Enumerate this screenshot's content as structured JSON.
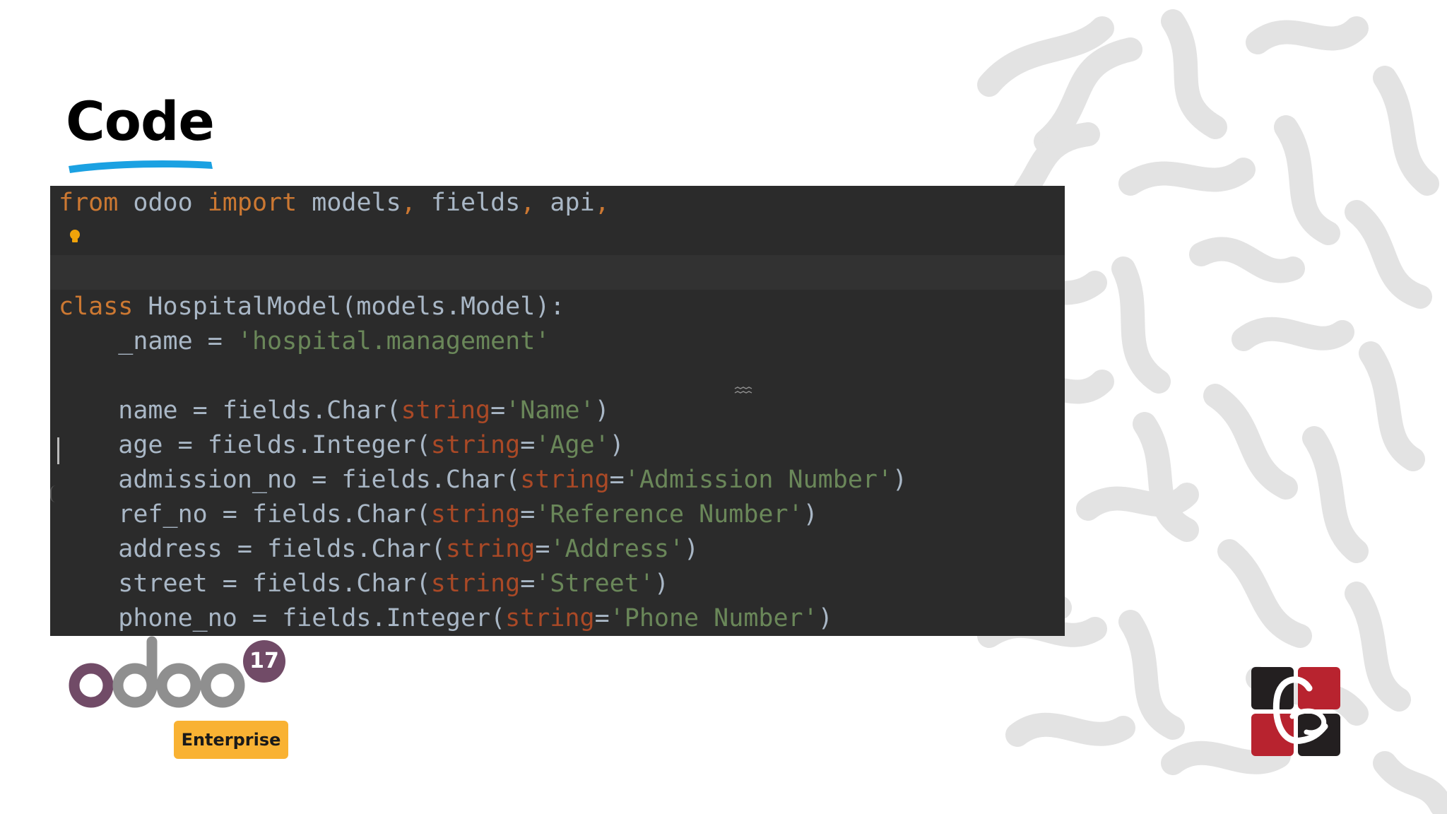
{
  "slide": {
    "title": "Code"
  },
  "code_editor": {
    "lines": [
      [
        {
          "t": "from",
          "c": "kw"
        },
        {
          "t": " odoo ",
          "c": "plain"
        },
        {
          "t": "import",
          "c": "kw"
        },
        {
          "t": " models",
          "c": "plain"
        },
        {
          "t": ",",
          "c": "kw"
        },
        {
          "t": " fields",
          "c": "plain"
        },
        {
          "t": ",",
          "c": "kw"
        },
        {
          "t": " api",
          "c": "plain"
        },
        {
          "t": ",",
          "c": "kw"
        }
      ],
      [],
      [],
      [
        {
          "t": "class",
          "c": "kw"
        },
        {
          "t": " HospitalModel(models.Model):",
          "c": "plain"
        }
      ],
      [
        {
          "t": "    _name = ",
          "c": "plain"
        },
        {
          "t": "'hospital.management'",
          "c": "str"
        }
      ],
      [],
      [
        {
          "t": "    name = fields.Char(",
          "c": "plain"
        },
        {
          "t": "string",
          "c": "param"
        },
        {
          "t": "=",
          "c": "plain"
        },
        {
          "t": "'Name'",
          "c": "str"
        },
        {
          "t": ")",
          "c": "plain"
        }
      ],
      [
        {
          "t": "    age = fields.Integer(",
          "c": "plain"
        },
        {
          "t": "string",
          "c": "param"
        },
        {
          "t": "=",
          "c": "plain"
        },
        {
          "t": "'Age'",
          "c": "str"
        },
        {
          "t": ")",
          "c": "plain"
        }
      ],
      [
        {
          "t": "    admission_no = fields.Char(",
          "c": "plain"
        },
        {
          "t": "string",
          "c": "param"
        },
        {
          "t": "=",
          "c": "plain"
        },
        {
          "t": "'Admission Number'",
          "c": "str"
        },
        {
          "t": ")",
          "c": "plain"
        }
      ],
      [
        {
          "t": "    ref_no = fields.Char(",
          "c": "plain"
        },
        {
          "t": "string",
          "c": "param"
        },
        {
          "t": "=",
          "c": "plain"
        },
        {
          "t": "'Reference Number'",
          "c": "str"
        },
        {
          "t": ")",
          "c": "plain"
        }
      ],
      [
        {
          "t": "    address = fields.Char(",
          "c": "plain"
        },
        {
          "t": "string",
          "c": "param"
        },
        {
          "t": "=",
          "c": "plain"
        },
        {
          "t": "'Address'",
          "c": "str"
        },
        {
          "t": ")",
          "c": "plain"
        }
      ],
      [
        {
          "t": "    street = fields.Char(",
          "c": "plain"
        },
        {
          "t": "string",
          "c": "param"
        },
        {
          "t": "=",
          "c": "plain"
        },
        {
          "t": "'Street'",
          "c": "str"
        },
        {
          "t": ")",
          "c": "plain"
        }
      ],
      [
        {
          "t": "    phone_no = fields.Integer(",
          "c": "plain"
        },
        {
          "t": "string",
          "c": "param"
        },
        {
          "t": "=",
          "c": "plain"
        },
        {
          "t": "'Phone Number'",
          "c": "str"
        },
        {
          "t": ")",
          "c": "plain"
        }
      ]
    ],
    "current_line_index": 2,
    "theme": {
      "background": "#2b2b2b",
      "keyword": "#cc7832",
      "parameter": "#aa4926",
      "string": "#6a8759",
      "default": "#a9b7c6"
    }
  },
  "icons": {
    "intention_bulb": "lightbulb-icon",
    "pattern": "decorative-squiggle-pattern"
  },
  "footer": {
    "product_logo_text": "odoo",
    "version": "17",
    "edition": "Enterprise",
    "brand_colors": {
      "odoo_purple": "#714b67",
      "odoo_grey": "#8f8f8f",
      "enterprise_yellow": "#f9b233",
      "accent_blue": "#1ba1e2",
      "logo_red": "#b8232f",
      "logo_dark": "#231f20"
    }
  }
}
